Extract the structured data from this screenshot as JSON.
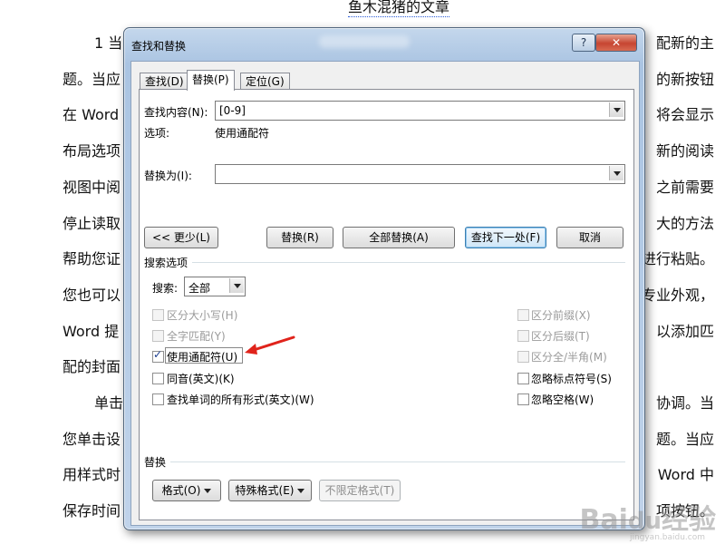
{
  "document": {
    "title": "鱼木混猪的文章",
    "left_lines": [
      "1 当",
      "题。当应",
      "在 Word",
      "布局选项",
      "视图中阅",
      "停止读取",
      "帮助您证",
      "您也可以",
      "Word 提",
      "配的封面",
      "单击",
      "您单击设",
      "用样式时",
      "保存时间"
    ],
    "right_lines": [
      "配新的主",
      "的新按钮",
      "将会显示",
      "新的阅读",
      "之前需要",
      "大的方法",
      "进行粘贴。",
      "专业外观，",
      "以添加匹",
      "",
      "协调。当",
      "题。当应",
      "Word 中",
      "项按钮。"
    ]
  },
  "dialog": {
    "title": "查找和替换",
    "help_label": "?",
    "close_label": "✕",
    "tabs": [
      {
        "label": "查找(D)"
      },
      {
        "label": "替换(P)"
      },
      {
        "label": "定位(G)"
      }
    ],
    "find_label": "查找内容(N):",
    "find_value": "[0-9]",
    "options_label": "选项:",
    "options_value": "使用通配符",
    "replace_label": "替换为(I):",
    "replace_value": "",
    "buttons": {
      "less": "<< 更少(L)",
      "replace": "替换(R)",
      "replace_all": "全部替换(A)",
      "find_next": "查找下一处(F)",
      "cancel": "取消"
    },
    "search_options_header": "搜索选项",
    "search_label": "搜索:",
    "search_value": "全部",
    "left_options": [
      {
        "label": "区分大小写(H)",
        "checked": false,
        "enabled": false
      },
      {
        "label": "全字匹配(Y)",
        "checked": false,
        "enabled": false
      },
      {
        "label": "使用通配符(U)",
        "checked": true,
        "enabled": true
      },
      {
        "label": "同音(英文)(K)",
        "checked": false,
        "enabled": true
      },
      {
        "label": "查找单词的所有形式(英文)(W)",
        "checked": false,
        "enabled": true
      }
    ],
    "right_options": [
      {
        "label": "区分前缀(X)",
        "checked": false,
        "enabled": false
      },
      {
        "label": "区分后缀(T)",
        "checked": false,
        "enabled": false
      },
      {
        "label": "区分全/半角(M)",
        "checked": false,
        "enabled": false
      },
      {
        "label": "忽略标点符号(S)",
        "checked": false,
        "enabled": true
      },
      {
        "label": "忽略空格(W)",
        "checked": false,
        "enabled": true
      }
    ],
    "replace_section_header": "替换",
    "format_buttons": {
      "format": "格式(O)",
      "special": "特殊格式(E)",
      "no_format": "不限定格式(T)"
    }
  },
  "annotation_arrow_color": "#e0231b",
  "watermark": {
    "text": "Baidu经验",
    "sub": "jingyan.baidu.com"
  }
}
